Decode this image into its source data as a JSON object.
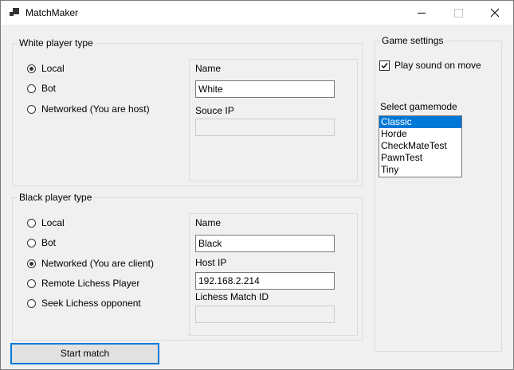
{
  "window": {
    "title": "MatchMaker"
  },
  "white": {
    "group_label": "White player type",
    "options": [
      {
        "label": "Local",
        "checked": true
      },
      {
        "label": "Bot",
        "checked": false
      },
      {
        "label": "Networked (You are host)",
        "checked": false
      }
    ],
    "name_label": "Name",
    "name_value": "White",
    "ip_label": "Souce IP",
    "ip_value": ""
  },
  "black": {
    "group_label": "Black player type",
    "options": [
      {
        "label": "Local",
        "checked": false
      },
      {
        "label": "Bot",
        "checked": false
      },
      {
        "label": "Networked (You are client)",
        "checked": true
      },
      {
        "label": "Remote Lichess Player",
        "checked": false
      },
      {
        "label": "Seek Lichess opponent",
        "checked": false
      }
    ],
    "name_label": "Name",
    "name_value": "Black",
    "ip_label": "Host IP",
    "ip_value": "192.168.2.214",
    "match_label": "Lichess Match ID",
    "match_value": ""
  },
  "settings": {
    "group_label": "Game settings",
    "sound_label": "Play sound on move",
    "sound_checked": true,
    "gamemode_label": "Select gamemode",
    "gamemodes": [
      "Classic",
      "Horde",
      "CheckMateTest",
      "PawnTest",
      "Tiny"
    ],
    "selected_gamemode": "Classic"
  },
  "start_label": "Start match",
  "colors": {
    "accent": "#0078d7"
  }
}
